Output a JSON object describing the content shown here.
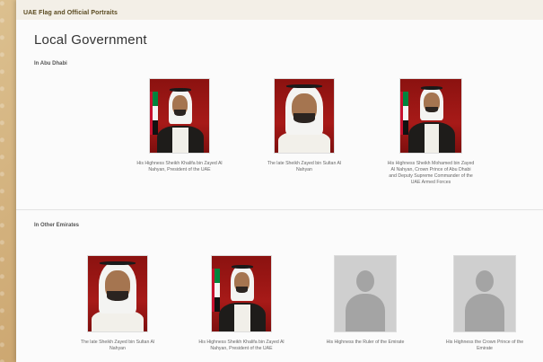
{
  "breadcrumb": "UAE Flag and Official Portraits",
  "title": "Local Government",
  "sections": [
    {
      "label": "In Abu Dhabi",
      "people": [
        {
          "caption": "His Highness Sheikh Khalifa bin Zayed Al Nahyan, President of the UAE"
        },
        {
          "caption": "The late Sheikh Zayed bin Sultan Al Nahyan"
        },
        {
          "caption": "His Highness Sheikh Mohamed bin Zayed Al Nahyan, Crown Prince of Abu Dhabi and Deputy Supreme Commander of the UAE Armed Forces"
        }
      ]
    },
    {
      "label": "In Other Emirates",
      "people": [
        {
          "caption": "The late Sheikh Zayed bin Sultan Al Nahyan"
        },
        {
          "caption": "His Highness Sheikh Khalifa bin Zayed Al Nahyan, President of the UAE"
        },
        {
          "caption": "His Highness the Ruler of the Emirate"
        },
        {
          "caption": "His Highness the Crown Prince of the Emirate"
        }
      ]
    }
  ],
  "colors": {
    "portrait_bg": "#a71a18",
    "placeholder_bg": "#cfcfcf",
    "flag": [
      "#c8102e",
      "#00843d",
      "#f4f4f4",
      "#111111"
    ]
  }
}
